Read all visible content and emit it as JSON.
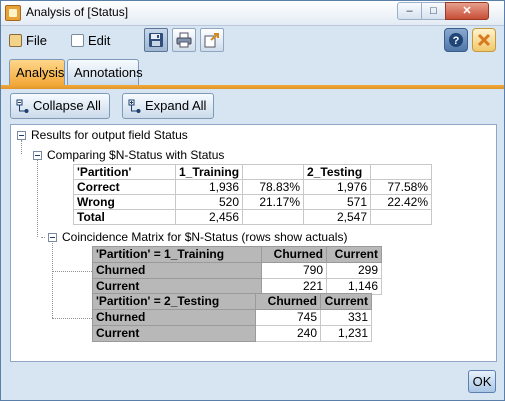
{
  "window": {
    "title": "Analysis of [Status]",
    "controls": {
      "minimize": "–",
      "maximize": "□",
      "close": "✕"
    }
  },
  "menu": {
    "file": "File",
    "edit": "Edit"
  },
  "toolbar_icons": [
    "save-icon",
    "print-icon",
    "export-icon",
    "help-icon",
    "close-panel-icon"
  ],
  "tabs": [
    {
      "label": "Analysis",
      "active": true
    },
    {
      "label": "Annotations",
      "active": false
    }
  ],
  "buttons": {
    "collapse_all": "Collapse All",
    "expand_all": "Expand All",
    "ok": "OK"
  },
  "tree": {
    "root": "Results for output field Status",
    "comparing": "Comparing $N-Status with Status",
    "coincidence": "Coincidence Matrix for $N-Status (rows show actuals)"
  },
  "comparison_table": {
    "headers": [
      "'Partition'",
      "1_Training",
      "",
      "2_Testing",
      ""
    ],
    "rows": [
      {
        "label": "Correct",
        "train_count": "1,936",
        "train_pct": "78.83%",
        "test_count": "1,976",
        "test_pct": "77.58%"
      },
      {
        "label": "Wrong",
        "train_count": "520",
        "train_pct": "21.17%",
        "test_count": "571",
        "test_pct": "22.42%"
      },
      {
        "label": "Total",
        "train_count": "2,456",
        "train_pct": "",
        "test_count": "2,547",
        "test_pct": ""
      }
    ]
  },
  "matrices": [
    {
      "corner": "'Partition' = 1_Training",
      "cols": [
        "Churned",
        "Current"
      ],
      "rows": [
        {
          "label": "Churned",
          "values": [
            "790",
            "299"
          ]
        },
        {
          "label": "Current",
          "values": [
            "221",
            "1,146"
          ]
        }
      ]
    },
    {
      "corner": "'Partition' = 2_Testing",
      "cols": [
        "Churned",
        "Current"
      ],
      "rows": [
        {
          "label": "Churned",
          "values": [
            "745",
            "331"
          ]
        },
        {
          "label": "Current",
          "values": [
            "240",
            "1,231"
          ]
        }
      ]
    }
  ],
  "colors": {
    "accent_tab": "#f3a838",
    "window_bg": "#d7e4f2",
    "matrix_header": "#b8b8b8"
  }
}
